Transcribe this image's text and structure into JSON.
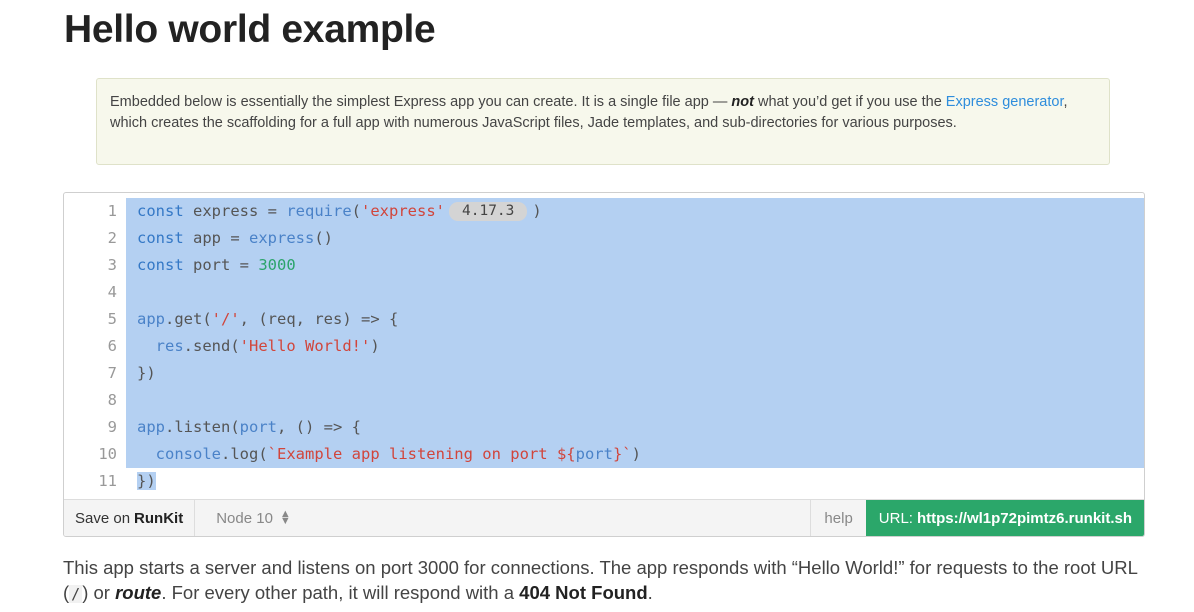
{
  "page": {
    "title": "Hello world example"
  },
  "callout": {
    "text_before": "Embedded below is essentially the simplest Express app you can create. It is a single file app — ",
    "emphasis": "not",
    "text_middle": " what you’d get if you use the ",
    "link": "Express generator",
    "text_after": ", which creates the scaffolding for a full app with numerous JavaScript files, Jade templates, and sub-directories for various purposes."
  },
  "editor": {
    "line_numbers": [
      "1",
      "2",
      "3",
      "4",
      "5",
      "6",
      "7",
      "8",
      "9",
      "10",
      "11"
    ],
    "code": {
      "l1_kw": "const",
      "l1_a": " express ",
      "l1_op": "= ",
      "l1_fn": "require",
      "l1_p": "(",
      "l1_str": "'express'",
      "l1_ver": "4.17.3",
      "l1_end": ")",
      "l2_kw": "const",
      "l2_a": " app ",
      "l2_op": "= ",
      "l2_fn": "express",
      "l2_end": "()",
      "l3_kw": "const",
      "l3_a": " port ",
      "l3_op": "= ",
      "l3_num": "3000",
      "l5_obj": "app",
      "l5_a": ".get(",
      "l5_str": "'/'",
      "l5_b": ", (req, res) => {",
      "l6_ind": "  ",
      "l6_obj": "res",
      "l6_a": ".send(",
      "l6_str": "'Hello World!'",
      "l6_end": ")",
      "l7": "})",
      "l9_obj": "app",
      "l9_a": ".listen(",
      "l9_kw": "port",
      "l9_b": ", () => {",
      "l10_ind": "  ",
      "l10_obj": "console",
      "l10_a": ".log(",
      "l10_str": "`Example app listening on port ${",
      "l10_var": "port",
      "l10_str2": "}`",
      "l10_end": ")",
      "l11": "})"
    }
  },
  "toolbar": {
    "save_prefix": "Save on",
    "save_brand": "RunKit",
    "node_version": "Node 10",
    "help": "help",
    "url_label": "URL:",
    "url_value": "https://wl1p72pimtz6.runkit.sh"
  },
  "paragraph": {
    "t1": "This app starts a server and listens on port 3000 for connections. The app responds with “Hello World!” for requests to the root URL (",
    "code": "/",
    "t2": ") or ",
    "route": "route",
    "t3": ". For every other path, it will respond with a ",
    "status": "404 Not Found",
    "t4": "."
  }
}
